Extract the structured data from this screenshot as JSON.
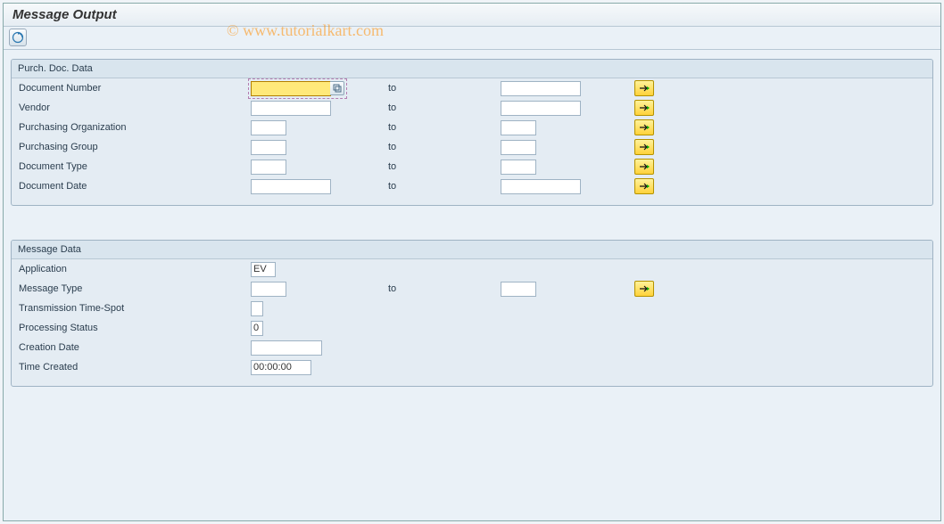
{
  "title": "Message Output",
  "watermark": "© www.tutorialkart.com",
  "group1": {
    "title": "Purch. Doc. Data",
    "rows": [
      {
        "label": "Document Number",
        "from": "",
        "toLabel": "to",
        "to": "",
        "size": "long",
        "multi": true,
        "focused": true,
        "f4": true
      },
      {
        "label": "Vendor",
        "from": "",
        "toLabel": "to",
        "to": "",
        "size": "long",
        "multi": true
      },
      {
        "label": "Purchasing Organization",
        "from": "",
        "toLabel": "to",
        "to": "",
        "size": "short",
        "multi": true
      },
      {
        "label": "Purchasing Group",
        "from": "",
        "toLabel": "to",
        "to": "",
        "size": "short",
        "multi": true
      },
      {
        "label": "Document Type",
        "from": "",
        "toLabel": "to",
        "to": "",
        "size": "short",
        "multi": true
      },
      {
        "label": "Document Date",
        "from": "",
        "toLabel": "to",
        "to": "",
        "size": "long",
        "multi": true
      }
    ]
  },
  "group2": {
    "title": "Message Data",
    "rows": [
      {
        "label": "Application",
        "from": "EV",
        "size": "tiny"
      },
      {
        "label": "Message Type",
        "from": "",
        "toLabel": "to",
        "to": "",
        "size": "short",
        "multi": true
      },
      {
        "label": "Transmission Time-Spot",
        "from": "",
        "size": "one"
      },
      {
        "label": "Processing Status",
        "from": "0",
        "size": "one"
      },
      {
        "label": "Creation Date",
        "from": "",
        "size": "date"
      },
      {
        "label": "Time Created",
        "from": "00:00:00",
        "size": "time"
      }
    ]
  }
}
